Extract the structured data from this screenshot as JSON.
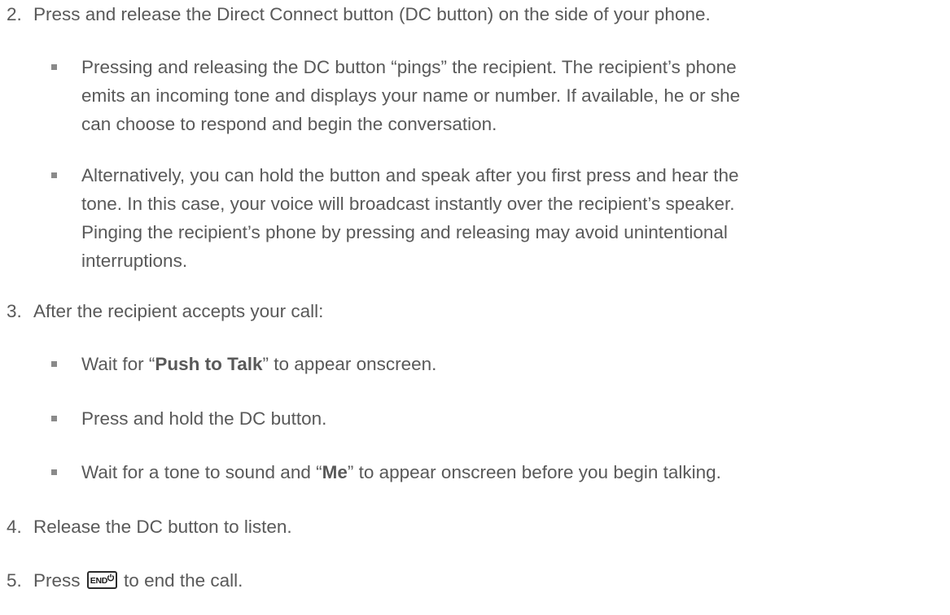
{
  "steps": [
    {
      "number": "2.",
      "text": "Press and release the Direct Connect button (DC button) on the side of your phone.",
      "bullets": [
        {
          "lines": [
            "Pressing and releasing the DC button “pings” the recipient. The recipient’s phone",
            "emits an incoming tone and displays your name or number. If available, he or she",
            "can choose to respond and begin the conversation."
          ]
        },
        {
          "lines": [
            "Alternatively, you can hold the button and speak after you first press and hear the",
            "tone. In this case, your voice will broadcast instantly over the recipient’s speaker.",
            "Pinging the recipient’s phone by pressing and releasing may avoid unintentional",
            "interruptions."
          ]
        }
      ]
    },
    {
      "number": "3.",
      "text": "After the recipient accepts your call:",
      "bullets": [
        {
          "before": "Wait for “",
          "bold": "Push to Talk",
          "after": "” to appear onscreen."
        },
        {
          "text": "Press and hold the DC button."
        },
        {
          "before": "Wait for a tone to sound and “",
          "bold": "Me",
          "after": "” to appear onscreen before you begin talking."
        }
      ]
    },
    {
      "number": "4.",
      "text": "Release the DC button to listen."
    },
    {
      "number": "5.",
      "before": "Press",
      "key_label": "END",
      "key_icon": "power-icon",
      "after": "to end the call."
    }
  ]
}
